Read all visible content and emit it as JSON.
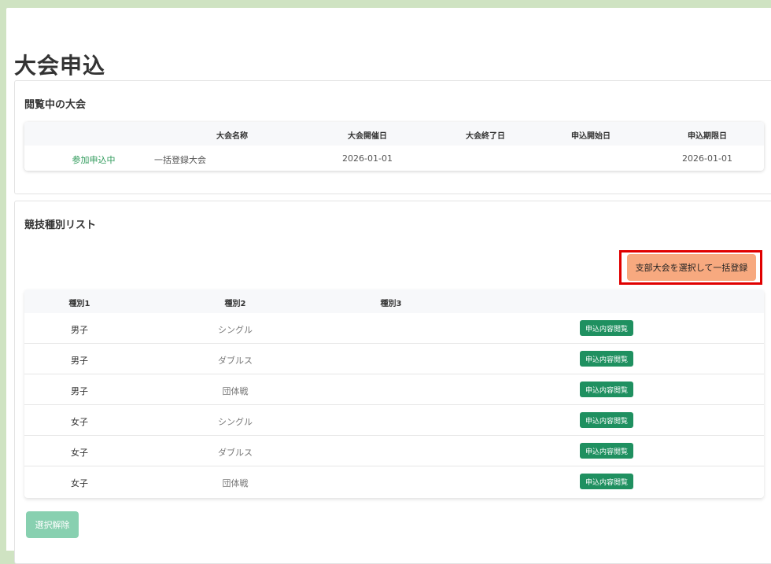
{
  "page": {
    "title": "大会申込"
  },
  "viewing": {
    "section_title": "閲覧中の大会",
    "headers": [
      "",
      "大会名称",
      "大会開催日",
      "大会終了日",
      "申込開始日",
      "申込期限日"
    ],
    "row": {
      "status": "参加申込中",
      "name": "一括登録大会",
      "start_date": "2026-01-01",
      "end_date": "",
      "apply_start": "",
      "apply_deadline": "2026-01-01"
    }
  },
  "events": {
    "section_title": "競技種別リスト",
    "bulk_button_label": "支部大会を選択して一括登録",
    "headers": [
      "種別1",
      "種別2",
      "種別3"
    ],
    "rows": [
      {
        "type1": "男子",
        "type2": "シングル",
        "type3": "",
        "action": "申込内容閲覧"
      },
      {
        "type1": "男子",
        "type2": "ダブルス",
        "type3": "",
        "action": "申込内容閲覧"
      },
      {
        "type1": "男子",
        "type2": "団体戦",
        "type3": "",
        "action": "申込内容閲覧"
      },
      {
        "type1": "女子",
        "type2": "シングル",
        "type3": "",
        "action": "申込内容閲覧"
      },
      {
        "type1": "女子",
        "type2": "ダブルス",
        "type3": "",
        "action": "申込内容閲覧"
      },
      {
        "type1": "女子",
        "type2": "団体戦",
        "type3": "",
        "action": "申込内容閲覧"
      }
    ],
    "clear_button_label": "選択解除"
  },
  "colors": {
    "background": "#cfe3c2",
    "bulk_button": "#f7a97f",
    "highlight_outline": "#e00000",
    "view_button": "#1f9060",
    "clear_button": "#88d0b0",
    "status_text": "#2e9a5a"
  }
}
